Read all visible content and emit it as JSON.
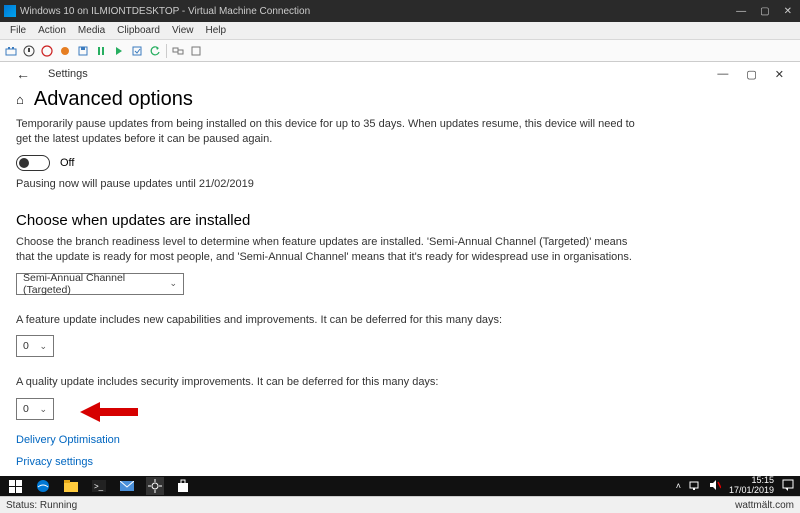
{
  "vm": {
    "title": "Windows 10 on ILMIONTDESKTOP - Virtual Machine Connection",
    "minimize": "—",
    "maximize": "▢",
    "close": "✕",
    "menu": {
      "file": "File",
      "action": "Action",
      "media": "Media",
      "clipboard": "Clipboard",
      "view": "View",
      "help": "Help"
    }
  },
  "settings": {
    "back": "←",
    "label": "Settings",
    "min": "—",
    "max": "▢",
    "close": "✕"
  },
  "page": {
    "home_icon": "⌂",
    "title": "Advanced options",
    "pause_intro": "Temporarily pause updates from being installed on this device for up to 35 days. When updates resume, this device will need to get the latest updates before it can be paused again.",
    "toggle_label": "Off",
    "pause_until": "Pausing now will pause updates until 21/02/2019",
    "choose_heading": "Choose when updates are installed",
    "branch_desc": "Choose the branch readiness level to determine when feature updates are installed. 'Semi-Annual Channel (Targeted)' means that the update is ready for most people, and 'Semi-Annual Channel' means that it's ready for widespread use in organisations.",
    "branch_selected": "Semi-Annual Channel (Targeted)",
    "feature_defer": "A feature update includes new capabilities and improvements. It can be deferred for this many days:",
    "feature_value": "0",
    "quality_defer": "A quality update includes security improvements. It can be deferred for this many days:",
    "quality_value": "0",
    "link_delivery": "Delivery Optimisation",
    "link_privacy": "Privacy settings"
  },
  "taskbar": {
    "time": "15:15",
    "date": "17/01/2019"
  },
  "status": {
    "left": "Status: Running",
    "right": "wattmält.com"
  }
}
